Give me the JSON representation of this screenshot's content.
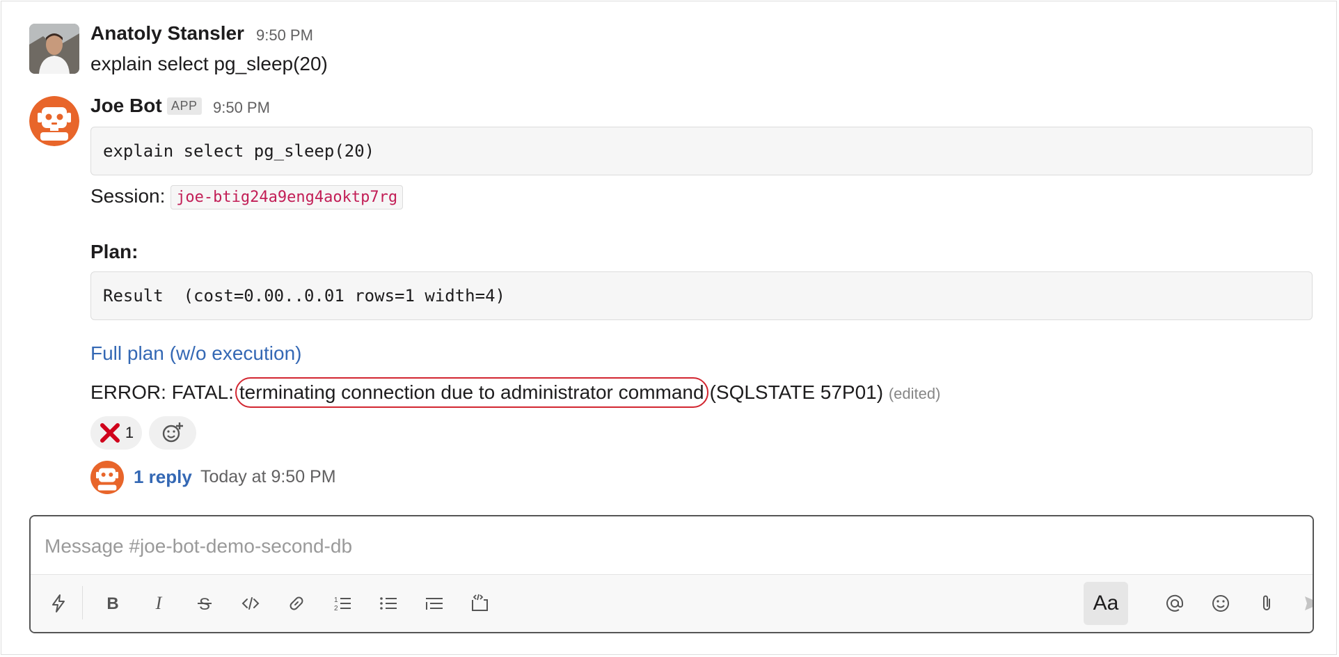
{
  "messages": [
    {
      "author": "Anatoly Stansler",
      "time": "9:50 PM",
      "text": "explain select pg_sleep(20)"
    },
    {
      "author": "Joe Bot",
      "badge": "APP",
      "time": "9:50 PM",
      "command_code": "explain select pg_sleep(20)",
      "session_label": "Session:",
      "session_id": "joe-btig24a9eng4aoktp7rg",
      "plan_label": "Plan:",
      "plan_code": "Result  (cost=0.00..0.01 rows=1 width=4)",
      "full_plan_link": "Full plan (w/o execution)",
      "error_prefix": "ERROR: FATAL:",
      "error_highlight": "terminating connection due to administrator command",
      "error_suffix": "(SQLSTATE 57P01)",
      "edited": "(edited)",
      "reactions": [
        {
          "emoji": "x-icon",
          "count": "1"
        }
      ],
      "thread": {
        "reply_count": "1 reply",
        "last_reply": "Today at 9:50 PM"
      }
    }
  ],
  "composer": {
    "placeholder": "Message #joe-bot-demo-second-db",
    "format_button": "Aa",
    "toolbar_icons": [
      "shortcuts-icon",
      "bold-icon",
      "italic-icon",
      "strikethrough-icon",
      "code-icon",
      "link-icon",
      "ordered-list-icon",
      "bulleted-list-icon",
      "blockquote-icon",
      "code-block-icon",
      "mention-icon",
      "emoji-icon",
      "attach-icon",
      "send-icon"
    ]
  },
  "colors": {
    "link": "#3468b4",
    "error_highlight_border": "#d22630",
    "inline_code": "#c21e56",
    "bot_orange": "#e8652a"
  }
}
